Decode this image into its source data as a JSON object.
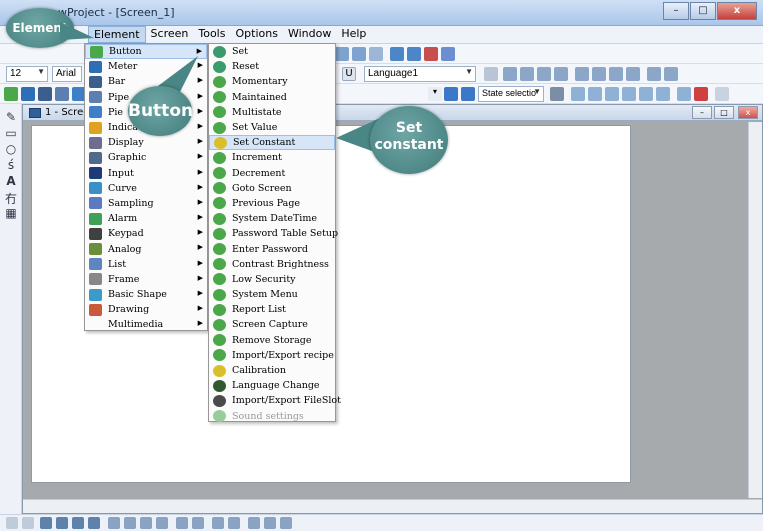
{
  "window": {
    "title_fragment": "wProject - [Screen_1]",
    "min": "–",
    "max": "□",
    "close": "x"
  },
  "menubar": [
    "Element",
    "Screen",
    "Tools",
    "Options",
    "Window",
    "Help"
  ],
  "toolbar": {
    "font_size": "12",
    "font_name": "Arial",
    "language": "Language1",
    "state": "State selectio"
  },
  "child_window": {
    "title": "1 - Screer"
  },
  "element_menu": [
    {
      "label": "Button",
      "icon": "button-icon",
      "color": "#4aa84a"
    },
    {
      "label": "Meter",
      "icon": "meter-icon",
      "color": "#2d6fb5"
    },
    {
      "label": "Bar",
      "icon": "bar-icon",
      "color": "#3b5e8e"
    },
    {
      "label": "Pipe",
      "icon": "pipe-icon",
      "color": "#5a7fb0"
    },
    {
      "label": "Pie",
      "icon": "pie-icon",
      "color": "#3f7fc6"
    },
    {
      "label": "Indica",
      "icon": "indicator-icon",
      "color": "#e0a21c"
    },
    {
      "label": "Display",
      "icon": "display-icon",
      "color": "#6d6d8f"
    },
    {
      "label": "Graphic",
      "icon": "graphic-icon",
      "color": "#4f6a8a"
    },
    {
      "label": "Input",
      "icon": "input-icon",
      "color": "#1d3b7a"
    },
    {
      "label": "Curve",
      "icon": "curve-icon",
      "color": "#3b8fc9"
    },
    {
      "label": "Sampling",
      "icon": "sampling-icon",
      "color": "#5c7ac2"
    },
    {
      "label": "Alarm",
      "icon": "alarm-icon",
      "color": "#3fa05a"
    },
    {
      "label": "Keypad",
      "icon": "keypad-icon",
      "color": "#404040"
    },
    {
      "label": "Analog",
      "icon": "analog-icon",
      "color": "#6a8f3a"
    },
    {
      "label": "List",
      "icon": "list-icon",
      "color": "#5b86c0"
    },
    {
      "label": "Frame",
      "icon": "frame-icon",
      "color": "#888888"
    },
    {
      "label": "Basic Shape",
      "icon": "basic-shape-icon",
      "color": "#3a9bc9"
    },
    {
      "label": "Drawing",
      "icon": "drawing-icon",
      "color": "#c9593a"
    },
    {
      "label": "Multimedia",
      "icon": "",
      "color": ""
    }
  ],
  "button_menu": [
    {
      "label": "Set",
      "color": "#3c9b6a",
      "highlight": false,
      "disabled": false
    },
    {
      "label": "Reset",
      "color": "#3c9b6a",
      "highlight": false,
      "disabled": false
    },
    {
      "label": "Momentary",
      "color": "#4aa84a",
      "highlight": false,
      "disabled": false
    },
    {
      "label": "Maintained",
      "color": "#4aa84a",
      "highlight": false,
      "disabled": false
    },
    {
      "label": "Multistate",
      "color": "#4aa84a",
      "highlight": false,
      "disabled": false
    },
    {
      "label": "Set Value",
      "color": "#4aa84a",
      "highlight": false,
      "disabled": false
    },
    {
      "label": "Set Constant",
      "color": "#d9c02a",
      "highlight": true,
      "disabled": false
    },
    {
      "label": "Increment",
      "color": "#4aa84a",
      "highlight": false,
      "disabled": false
    },
    {
      "label": "Decrement",
      "color": "#4aa84a",
      "highlight": false,
      "disabled": false
    },
    {
      "label": "Goto Screen",
      "color": "#4aa84a",
      "highlight": false,
      "disabled": false
    },
    {
      "label": "Previous Page",
      "color": "#4aa84a",
      "highlight": false,
      "disabled": false
    },
    {
      "label": "System DateTime",
      "color": "#4aa84a",
      "highlight": false,
      "disabled": false
    },
    {
      "label": "Password Table Setup",
      "color": "#4aa84a",
      "highlight": false,
      "disabled": false
    },
    {
      "label": "Enter Password",
      "color": "#4aa84a",
      "highlight": false,
      "disabled": false
    },
    {
      "label": "Contrast Brightness",
      "color": "#4aa84a",
      "highlight": false,
      "disabled": false
    },
    {
      "label": "Low Security",
      "color": "#4aa84a",
      "highlight": false,
      "disabled": false
    },
    {
      "label": "System Menu",
      "color": "#4aa84a",
      "highlight": false,
      "disabled": false
    },
    {
      "label": "Report List",
      "color": "#4aa84a",
      "highlight": false,
      "disabled": false
    },
    {
      "label": "Screen Capture",
      "color": "#4aa84a",
      "highlight": false,
      "disabled": false
    },
    {
      "label": "Remove Storage",
      "color": "#4aa84a",
      "highlight": false,
      "disabled": false
    },
    {
      "label": "Import/Export recipe",
      "color": "#4aa84a",
      "highlight": false,
      "disabled": false
    },
    {
      "label": "Calibration",
      "color": "#d9c02a",
      "highlight": false,
      "disabled": false
    },
    {
      "label": "Language Change",
      "color": "#2f5a2f",
      "highlight": false,
      "disabled": false
    },
    {
      "label": "Import/Export FileSlot",
      "color": "#4a4a4a",
      "highlight": false,
      "disabled": false
    },
    {
      "label": "Sound settings",
      "color": "#9acb9a",
      "highlight": false,
      "disabled": true
    }
  ],
  "callouts": {
    "element": "Element",
    "button": "Button",
    "set_constant_1": "Set",
    "set_constant_2": "constant"
  }
}
